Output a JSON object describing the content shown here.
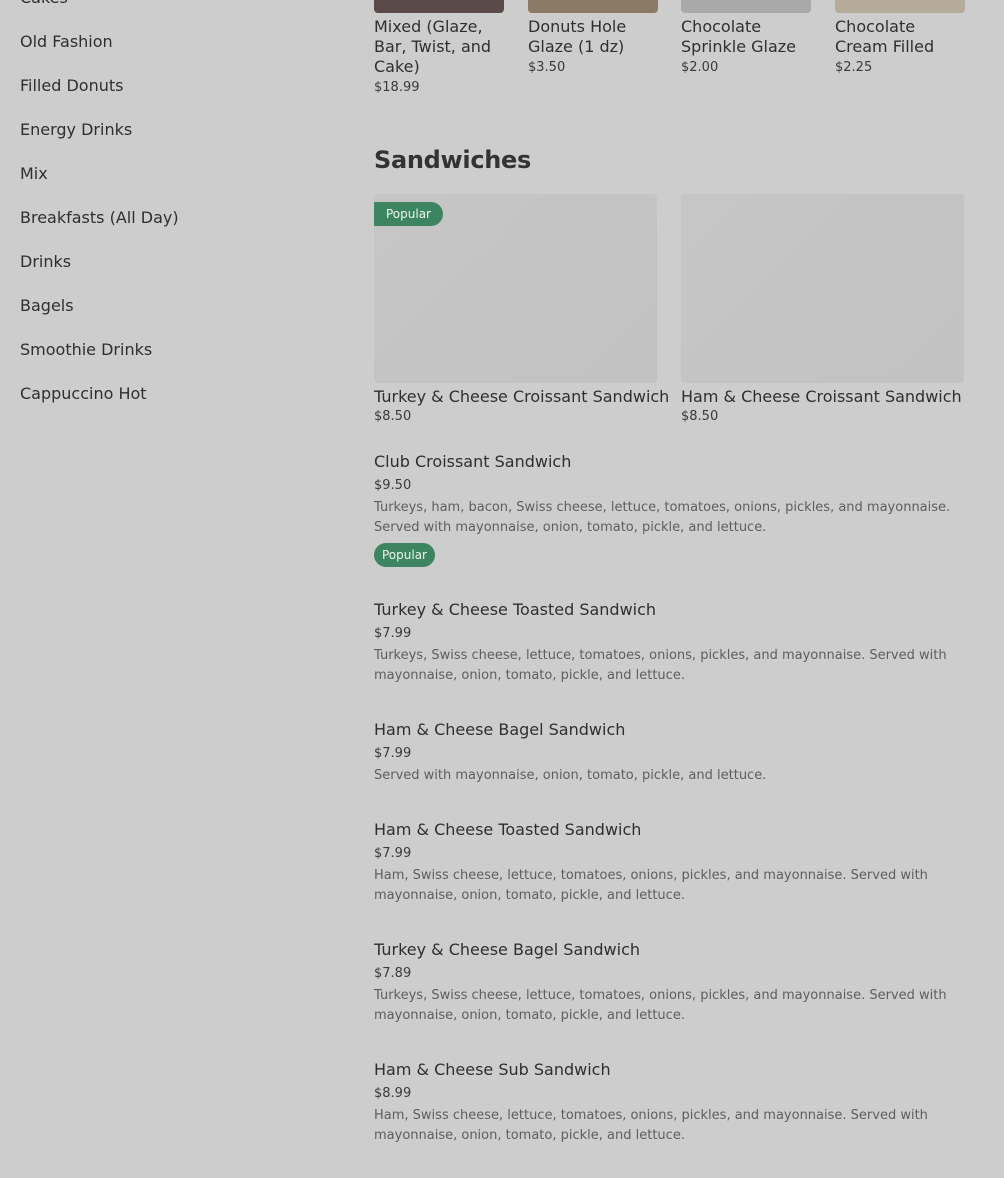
{
  "sidebar": {
    "items": [
      {
        "label": "Cakes"
      },
      {
        "label": "Old Fashion"
      },
      {
        "label": "Filled Donuts"
      },
      {
        "label": "Energy Drinks"
      },
      {
        "label": "Mix"
      },
      {
        "label": "Breakfasts (All Day)"
      },
      {
        "label": "Drinks"
      },
      {
        "label": "Bagels"
      },
      {
        "label": "Smoothie Drinks"
      },
      {
        "label": "Cappuccino Hot"
      }
    ]
  },
  "donuts": [
    {
      "name": "Mixed (Glaze, Bar, Twist, and Cake)",
      "price": "$18.99",
      "thumb_color": "#5a4a4a"
    },
    {
      "name": "Donuts Hole Glaze (1 dz)",
      "price": "$3.50",
      "thumb_color": "#8b7a66"
    },
    {
      "name": "Chocolate Sprinkle Glaze",
      "price": "$2.00",
      "thumb_color": "#a9a9a9"
    },
    {
      "name": "Chocolate Cream Filled",
      "price": "$2.25",
      "thumb_color": "#b5ab9a"
    }
  ],
  "section": {
    "title": "Sandwiches"
  },
  "badge_label": "Popular",
  "featured": [
    {
      "name": "Turkey & Cheese Croissant Sandwich",
      "price": "$8.50",
      "popular": true
    },
    {
      "name": "Ham & Cheese Croissant Sandwich",
      "price": "$8.50",
      "popular": false
    }
  ],
  "items": [
    {
      "name": "Club Croissant Sandwich",
      "price": "$9.50",
      "description": "Turkeys, ham, bacon, Swiss cheese, lettuce, tomatoes, onions, pickles, and mayonnaise. Served with mayonnaise, onion, tomato, pickle, and lettuce.",
      "popular": true
    },
    {
      "name": "Turkey & Cheese Toasted Sandwich",
      "price": "$7.99",
      "description": "Turkeys, Swiss cheese, lettuce, tomatoes, onions, pickles, and mayonnaise. Served with mayonnaise, onion, tomato, pickle, and lettuce.",
      "popular": false
    },
    {
      "name": "Ham & Cheese Bagel Sandwich",
      "price": "$7.99",
      "description": "Served with mayonnaise, onion, tomato, pickle, and lettuce.",
      "popular": false
    },
    {
      "name": "Ham & Cheese Toasted Sandwich",
      "price": "$7.99",
      "description": "Ham, Swiss cheese, lettuce, tomatoes, onions, pickles, and mayonnaise. Served with mayonnaise, onion, tomato, pickle, and lettuce.",
      "popular": false
    },
    {
      "name": "Turkey & Cheese Bagel Sandwich",
      "price": "$7.89",
      "description": "Turkeys, Swiss cheese, lettuce, tomatoes, onions, pickles, and mayonnaise. Served with mayonnaise, onion, tomato, pickle, and lettuce.",
      "popular": false
    },
    {
      "name": "Ham & Cheese Sub Sandwich",
      "price": "$8.99",
      "description": "Ham, Swiss cheese, lettuce, tomatoes, onions, pickles, and mayonnaise. Served with mayonnaise, onion, tomato, pickle, and lettuce.",
      "popular": false
    }
  ]
}
